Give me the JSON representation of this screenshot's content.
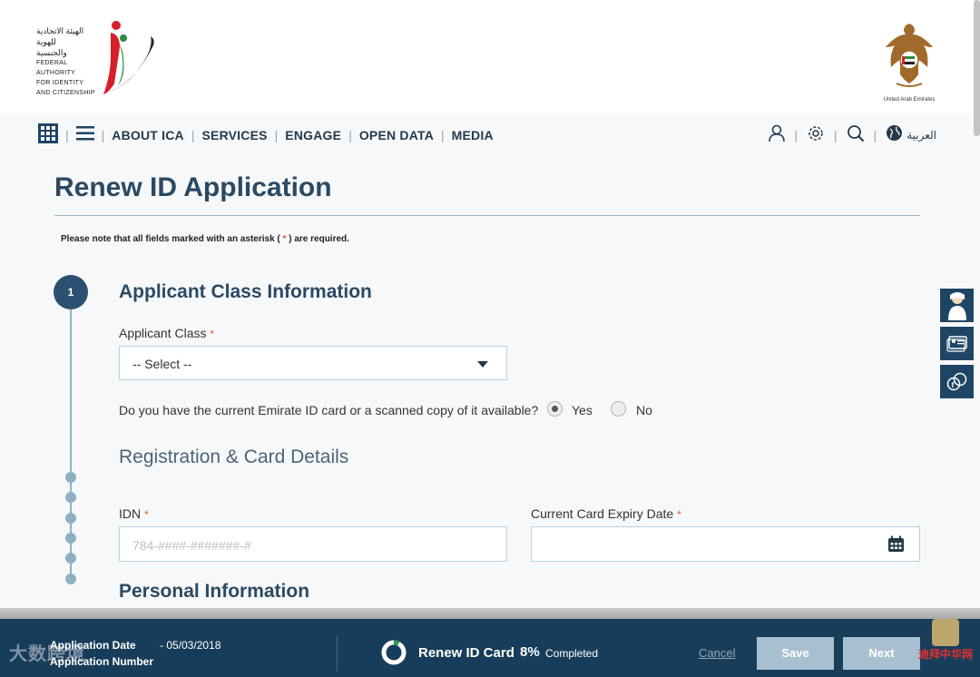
{
  "header": {
    "ica_logo_text_ar": [
      "الهيئة الاتحادية",
      "للهوية",
      "والجنسية"
    ],
    "ica_logo_text_en": [
      "FEDERAL AUTHORITY",
      "FOR IDENTITY",
      "AND CITIZENSHIP"
    ],
    "uae_emblem_caption": "United Arab Emirates"
  },
  "nav": {
    "items": [
      "ABOUT ICA",
      "SERVICES",
      "ENGAGE",
      "OPEN DATA",
      "MEDIA"
    ],
    "language": "العربية"
  },
  "page": {
    "title": "Renew ID Application",
    "note_prefix": "Please note that all fields marked with an asterisk (",
    "note_asterisk": "*",
    "note_suffix": ") are required."
  },
  "steps": {
    "current": "1"
  },
  "sections": {
    "applicant_class": {
      "heading": "Applicant Class Information",
      "class_label": "Applicant Class",
      "class_value": "-- Select --",
      "question": "Do you have the current Emirate ID card or a scanned copy of it available?",
      "yes_label": "Yes",
      "no_label": "No",
      "selected": "Yes"
    },
    "registration": {
      "heading": "Registration & Card Details",
      "idn_label": "IDN",
      "idn_placeholder": "784-####-#######-#",
      "expiry_label": "Current Card Expiry Date",
      "expiry_value": ""
    },
    "personal": {
      "heading": "Personal Information"
    }
  },
  "required_marker": "*",
  "bottom_bar": {
    "application_date_label": "Application Date",
    "application_date_value": "- 05/03/2018",
    "application_number_label": "Application Number",
    "service_name": "Renew ID Card",
    "progress_percent": "8%",
    "progress_fraction": 0.08,
    "completed_label": "Completed",
    "cancel_label": "Cancel",
    "save_label": "Save",
    "next_label": "Next"
  },
  "watermarks": {
    "left": "大数跨境",
    "right": "迪拜中华网"
  },
  "colors": {
    "primary": "#2b4a63",
    "bottom_bar": "#183d5a",
    "required": "#e05a2a",
    "button_disabled": "#a8bfd0",
    "side_widget": "#1f4564"
  },
  "icons": [
    "grid-icon",
    "hamburger-menu-icon",
    "user-icon",
    "gear-icon",
    "search-icon",
    "globe-icon",
    "calendar-icon",
    "dropdown-caret-icon",
    "assistant-icon",
    "id-card-icon",
    "social-icon",
    "progress-ring-icon"
  ]
}
